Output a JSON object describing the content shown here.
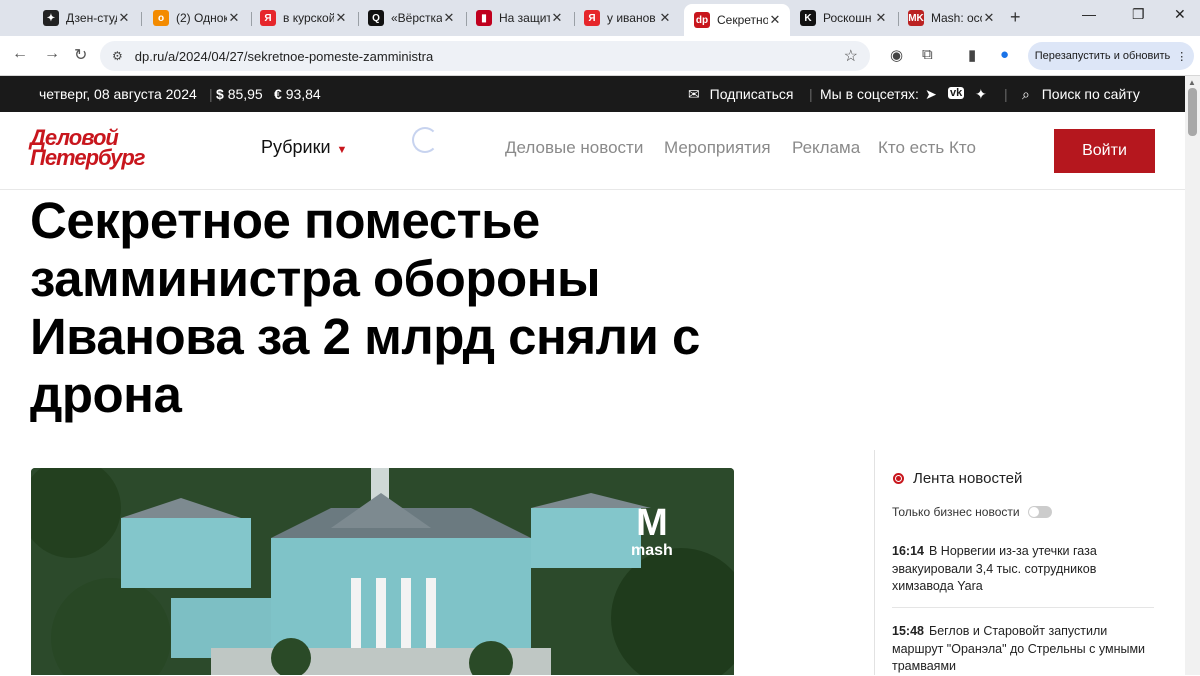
{
  "tabs": [
    {
      "label": "Дзен-студ",
      "fav_color": "#222",
      "fav_glyph": "✦"
    },
    {
      "label": "(2) Однок",
      "fav_color": "#f38b00",
      "fav_glyph": "о"
    },
    {
      "label": "в курской",
      "fav_color": "#e6262b",
      "fav_glyph": "Я"
    },
    {
      "label": "«Вёрстка",
      "fav_color": "#111",
      "fav_glyph": "Q"
    },
    {
      "label": "На защит",
      "fav_color": "#c0001e",
      "fav_glyph": "▮"
    },
    {
      "label": "у иванов",
      "fav_color": "#e6262b",
      "fav_glyph": "Я"
    },
    {
      "label": "Секретно",
      "fav_color": "#c8161d",
      "fav_glyph": "dp"
    },
    {
      "label": "Роскошн",
      "fav_color": "#111",
      "fav_glyph": "K"
    },
    {
      "label": "Mash: осс",
      "fav_color": "#b22",
      "fav_glyph": "MK"
    }
  ],
  "browser": {
    "url": "dp.ru/a/2024/04/27/sekretnoe-pomeste-zamministra",
    "restart_label": "Перезапустить и обновить"
  },
  "topbar": {
    "date": "четверг, 08 августа 2024",
    "usd": "85,95",
    "eur": "93,84",
    "subscribe": "Подписаться",
    "social": "Мы в соцсетях:",
    "search": "Поиск по сайту"
  },
  "header": {
    "logo_line1": "Деловой",
    "logo_line2": "Петербург",
    "rubrics": "Рубрики",
    "nav": [
      "Деловые новости",
      "Мероприятия",
      "Реклама",
      "Кто есть Кто"
    ],
    "login": "Войти"
  },
  "article": {
    "title": "Секретное поместье замминистра обороны Иванова за 2 млрд сняли с дрона",
    "watermark": "mash"
  },
  "sidebar": {
    "feed_title": "Лента новостей",
    "only_business": "Только бизнес новости",
    "news": [
      {
        "time": "16:14",
        "text": "В Норвегии из-за утечки газа эвакуировали 3,4 тыс. сотрудников химзавода Yara"
      },
      {
        "time": "15:48",
        "text": "Беглов и Старовойт запустили маршрут \"Оранэла\" до Стрельны с умными трамваями"
      }
    ]
  },
  "colors": {
    "brand": "#c8161d",
    "topbar_bg": "#1a1a1a",
    "button_red": "#b5171e"
  }
}
